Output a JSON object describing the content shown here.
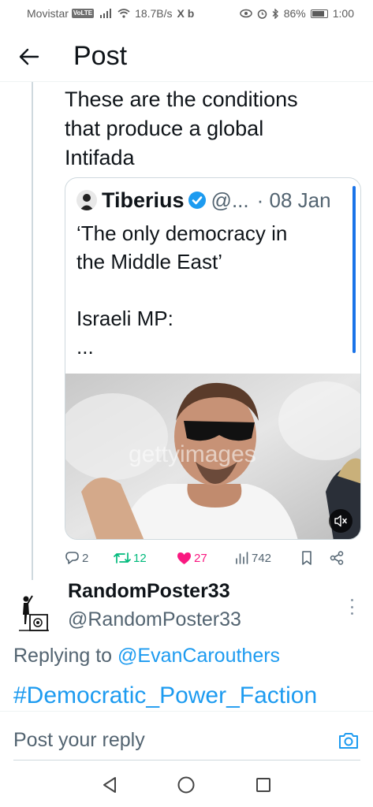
{
  "status_bar": {
    "carrier": "Movistar",
    "volte": "VoLTE",
    "speed": "18.7B/s",
    "app_letters": "X b",
    "battery": "86%",
    "time": "1:00"
  },
  "header": {
    "title": "Post"
  },
  "tweet": {
    "text_lines": [
      "These are the conditions",
      "that produce a global",
      "Intifada"
    ]
  },
  "quote": {
    "name": "Tiberius",
    "handle": "@...",
    "date": "· 08 Jan",
    "text_lines": [
      "‘The only democracy in",
      "the Middle East’",
      "",
      "Israeli MP:",
      "..."
    ],
    "watermark": "gettyimages"
  },
  "actions": {
    "replies": "2",
    "reposts": "12",
    "likes": "27",
    "views": "742"
  },
  "reply": {
    "name": "RandomPoster33",
    "handle": "@RandomPoster33",
    "replying_prefix": "Replying to",
    "replying_to": "@EvanCarouthers",
    "hashtag": "#Democratic_Power_Faction"
  },
  "composer": {
    "placeholder": "Post your reply"
  },
  "colors": {
    "accent": "#1d9bf0",
    "like": "#f91880",
    "repost": "#00ba7c",
    "text": "#0f1419",
    "muted": "#536471"
  }
}
